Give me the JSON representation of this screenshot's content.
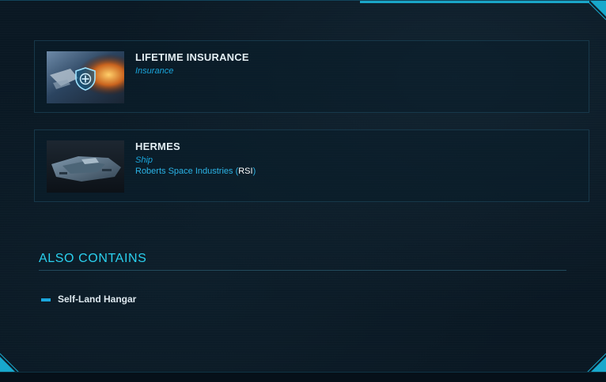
{
  "items": [
    {
      "title": "LIFETIME INSURANCE",
      "type": "Insurance",
      "thumbnail_icon": "shield-plus-icon"
    },
    {
      "title": "HERMES",
      "type": "Ship",
      "manufacturer_name": "Roberts Space Industries (",
      "manufacturer_code": "RSI",
      "manufacturer_close": ")",
      "thumbnail_icon": "ship-image"
    }
  ],
  "also_contains": {
    "title": "ALSO CONTAINS",
    "items": [
      {
        "label": "Self-Land Hangar"
      }
    ]
  },
  "colors": {
    "accent": "#2ad0ee",
    "link": "#1aa6dc",
    "background": "#0a1823"
  }
}
